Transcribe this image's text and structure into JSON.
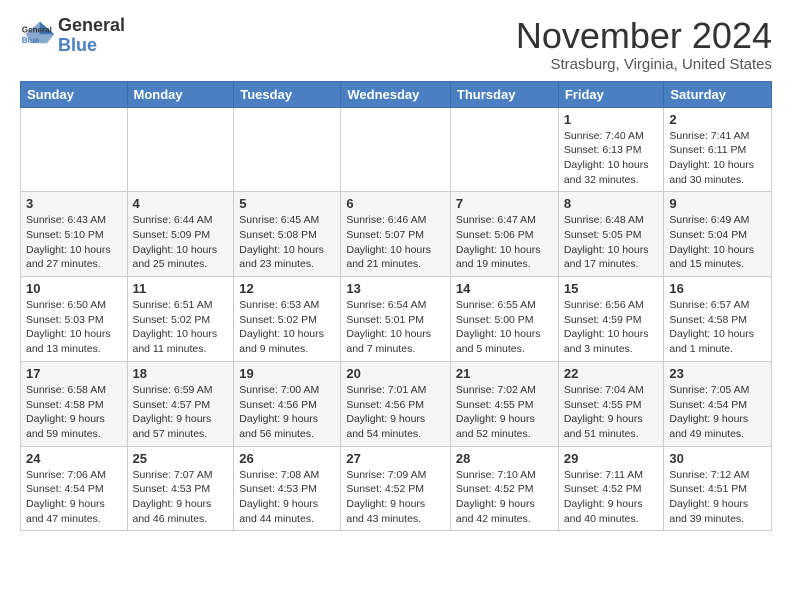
{
  "header": {
    "logo_line1": "General",
    "logo_line2": "Blue",
    "month": "November 2024",
    "location": "Strasburg, Virginia, United States"
  },
  "days_of_week": [
    "Sunday",
    "Monday",
    "Tuesday",
    "Wednesday",
    "Thursday",
    "Friday",
    "Saturday"
  ],
  "weeks": [
    [
      {
        "day": "",
        "info": ""
      },
      {
        "day": "",
        "info": ""
      },
      {
        "day": "",
        "info": ""
      },
      {
        "day": "",
        "info": ""
      },
      {
        "day": "",
        "info": ""
      },
      {
        "day": "1",
        "info": "Sunrise: 7:40 AM\nSunset: 6:13 PM\nDaylight: 10 hours\nand 32 minutes."
      },
      {
        "day": "2",
        "info": "Sunrise: 7:41 AM\nSunset: 6:11 PM\nDaylight: 10 hours\nand 30 minutes."
      }
    ],
    [
      {
        "day": "3",
        "info": "Sunrise: 6:43 AM\nSunset: 5:10 PM\nDaylight: 10 hours\nand 27 minutes."
      },
      {
        "day": "4",
        "info": "Sunrise: 6:44 AM\nSunset: 5:09 PM\nDaylight: 10 hours\nand 25 minutes."
      },
      {
        "day": "5",
        "info": "Sunrise: 6:45 AM\nSunset: 5:08 PM\nDaylight: 10 hours\nand 23 minutes."
      },
      {
        "day": "6",
        "info": "Sunrise: 6:46 AM\nSunset: 5:07 PM\nDaylight: 10 hours\nand 21 minutes."
      },
      {
        "day": "7",
        "info": "Sunrise: 6:47 AM\nSunset: 5:06 PM\nDaylight: 10 hours\nand 19 minutes."
      },
      {
        "day": "8",
        "info": "Sunrise: 6:48 AM\nSunset: 5:05 PM\nDaylight: 10 hours\nand 17 minutes."
      },
      {
        "day": "9",
        "info": "Sunrise: 6:49 AM\nSunset: 5:04 PM\nDaylight: 10 hours\nand 15 minutes."
      }
    ],
    [
      {
        "day": "10",
        "info": "Sunrise: 6:50 AM\nSunset: 5:03 PM\nDaylight: 10 hours\nand 13 minutes."
      },
      {
        "day": "11",
        "info": "Sunrise: 6:51 AM\nSunset: 5:02 PM\nDaylight: 10 hours\nand 11 minutes."
      },
      {
        "day": "12",
        "info": "Sunrise: 6:53 AM\nSunset: 5:02 PM\nDaylight: 10 hours\nand 9 minutes."
      },
      {
        "day": "13",
        "info": "Sunrise: 6:54 AM\nSunset: 5:01 PM\nDaylight: 10 hours\nand 7 minutes."
      },
      {
        "day": "14",
        "info": "Sunrise: 6:55 AM\nSunset: 5:00 PM\nDaylight: 10 hours\nand 5 minutes."
      },
      {
        "day": "15",
        "info": "Sunrise: 6:56 AM\nSunset: 4:59 PM\nDaylight: 10 hours\nand 3 minutes."
      },
      {
        "day": "16",
        "info": "Sunrise: 6:57 AM\nSunset: 4:58 PM\nDaylight: 10 hours\nand 1 minute."
      }
    ],
    [
      {
        "day": "17",
        "info": "Sunrise: 6:58 AM\nSunset: 4:58 PM\nDaylight: 9 hours\nand 59 minutes."
      },
      {
        "day": "18",
        "info": "Sunrise: 6:59 AM\nSunset: 4:57 PM\nDaylight: 9 hours\nand 57 minutes."
      },
      {
        "day": "19",
        "info": "Sunrise: 7:00 AM\nSunset: 4:56 PM\nDaylight: 9 hours\nand 56 minutes."
      },
      {
        "day": "20",
        "info": "Sunrise: 7:01 AM\nSunset: 4:56 PM\nDaylight: 9 hours\nand 54 minutes."
      },
      {
        "day": "21",
        "info": "Sunrise: 7:02 AM\nSunset: 4:55 PM\nDaylight: 9 hours\nand 52 minutes."
      },
      {
        "day": "22",
        "info": "Sunrise: 7:04 AM\nSunset: 4:55 PM\nDaylight: 9 hours\nand 51 minutes."
      },
      {
        "day": "23",
        "info": "Sunrise: 7:05 AM\nSunset: 4:54 PM\nDaylight: 9 hours\nand 49 minutes."
      }
    ],
    [
      {
        "day": "24",
        "info": "Sunrise: 7:06 AM\nSunset: 4:54 PM\nDaylight: 9 hours\nand 47 minutes."
      },
      {
        "day": "25",
        "info": "Sunrise: 7:07 AM\nSunset: 4:53 PM\nDaylight: 9 hours\nand 46 minutes."
      },
      {
        "day": "26",
        "info": "Sunrise: 7:08 AM\nSunset: 4:53 PM\nDaylight: 9 hours\nand 44 minutes."
      },
      {
        "day": "27",
        "info": "Sunrise: 7:09 AM\nSunset: 4:52 PM\nDaylight: 9 hours\nand 43 minutes."
      },
      {
        "day": "28",
        "info": "Sunrise: 7:10 AM\nSunset: 4:52 PM\nDaylight: 9 hours\nand 42 minutes."
      },
      {
        "day": "29",
        "info": "Sunrise: 7:11 AM\nSunset: 4:52 PM\nDaylight: 9 hours\nand 40 minutes."
      },
      {
        "day": "30",
        "info": "Sunrise: 7:12 AM\nSunset: 4:51 PM\nDaylight: 9 hours\nand 39 minutes."
      }
    ]
  ]
}
